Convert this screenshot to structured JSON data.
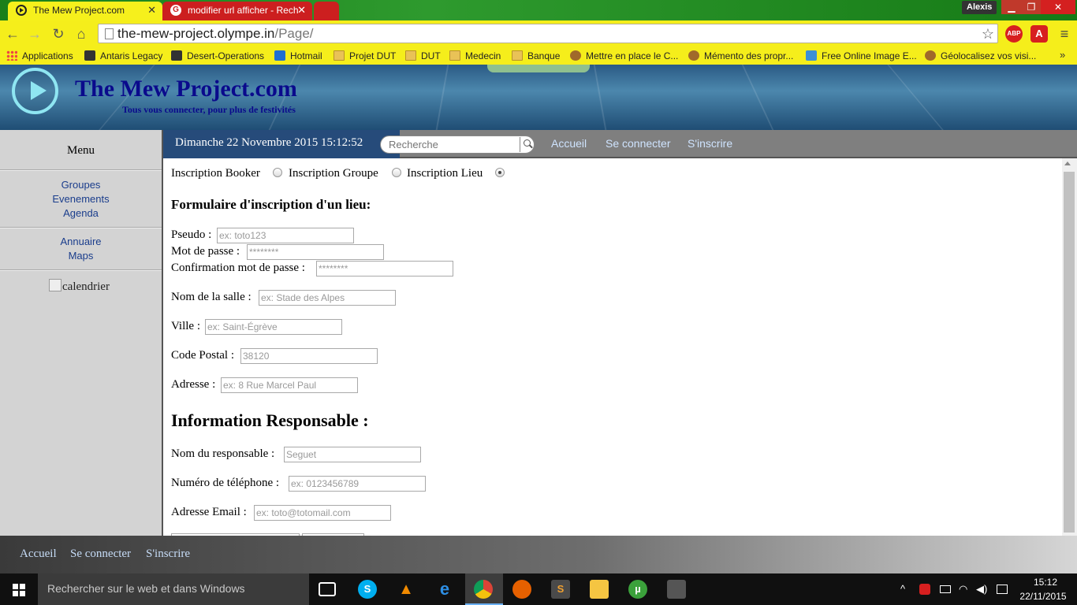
{
  "browser": {
    "tabs": [
      {
        "title": "The Mew Project.com",
        "close": "✕"
      },
      {
        "title": "modifier url afficher - Rech",
        "close": "✕"
      }
    ],
    "user": "Alexis",
    "window_controls": {
      "minimize": "▁",
      "maximize": "❐",
      "close": "✕"
    },
    "nav": {
      "back": "←",
      "forward": "→",
      "reload": "↻",
      "home": "⌂"
    },
    "url": {
      "host": "the-mew-project.olympe.in",
      "path": "/Page/"
    },
    "extensions": {
      "abp": "ABP",
      "avira": "A"
    },
    "menu_icon": "≡",
    "star_icon": "☆",
    "bookmarks": [
      {
        "label": "Applications",
        "icon": "apps-icon"
      },
      {
        "label": "Antaris Legacy",
        "icon": "game-icon"
      },
      {
        "label": "Desert-Operations",
        "icon": "game-icon"
      },
      {
        "label": "Hotmail",
        "icon": "outlook-icon"
      },
      {
        "label": "Projet DUT",
        "icon": "folder-icon"
      },
      {
        "label": "DUT",
        "icon": "folder-icon"
      },
      {
        "label": "Medecin",
        "icon": "folder-icon"
      },
      {
        "label": "Banque",
        "icon": "folder-icon"
      },
      {
        "label": "Mettre en place le C...",
        "icon": "site-icon"
      },
      {
        "label": "Mémento des propr...",
        "icon": "site-icon"
      },
      {
        "label": "Free Online Image E...",
        "icon": "image-icon"
      },
      {
        "label": "Géolocalisez vos visi...",
        "icon": "site-icon"
      }
    ],
    "bookmarks_more": "»"
  },
  "site": {
    "title": "The Mew Project.com",
    "tagline": "Tous vous connecter, pour plus de festivités"
  },
  "sidebar": {
    "title": "Menu",
    "group1": [
      "Groupes",
      "Evenements",
      "Agenda"
    ],
    "group2": [
      "Annuaire",
      "Maps"
    ],
    "calendar_alt": "calendrier"
  },
  "topnav": {
    "datetime": "Dimanche 22 Novembre 2015 15:12:52",
    "search_placeholder": "Recherche",
    "links": [
      "Accueil",
      "Se connecter",
      "S'inscrire"
    ]
  },
  "form": {
    "radios": [
      {
        "label": "Inscription Booker",
        "checked": false
      },
      {
        "label": "Inscription Groupe",
        "checked": false
      },
      {
        "label": "Inscription Lieu",
        "checked": true
      }
    ],
    "heading": "Formulaire d'inscription d'un lieu:",
    "fields": {
      "pseudo": {
        "label": "Pseudo :",
        "placeholder": "ex: toto123"
      },
      "password": {
        "label": "Mot de passe :",
        "placeholder": "********"
      },
      "confirm": {
        "label": "Confirmation mot de passe :",
        "placeholder": "********"
      },
      "salle": {
        "label": "Nom de la salle :",
        "placeholder": "ex: Stade des Alpes"
      },
      "ville": {
        "label": "Ville :",
        "placeholder": "ex: Saint-Égrève"
      },
      "cp": {
        "label": "Code Postal :",
        "placeholder": "38120"
      },
      "adresse": {
        "label": "Adresse :",
        "placeholder": "ex: 8 Rue Marcel Paul"
      }
    },
    "section2": "Information Responsable :",
    "fields2": {
      "responsable": {
        "label": "Nom du responsable :",
        "placeholder": "Seguet"
      },
      "telephone": {
        "label": "Numéro de téléphone :",
        "placeholder": "ex: 0123456789"
      },
      "email": {
        "label": "Adresse Email :",
        "placeholder": "ex: toto@totomail.com"
      }
    }
  },
  "footer": {
    "links": [
      "Accueil",
      "Se connecter",
      "S'inscrire"
    ]
  },
  "taskbar": {
    "search_text": "Rechercher sur le web et dans Windows",
    "clock_time": "15:12",
    "clock_date": "22/11/2015"
  }
}
